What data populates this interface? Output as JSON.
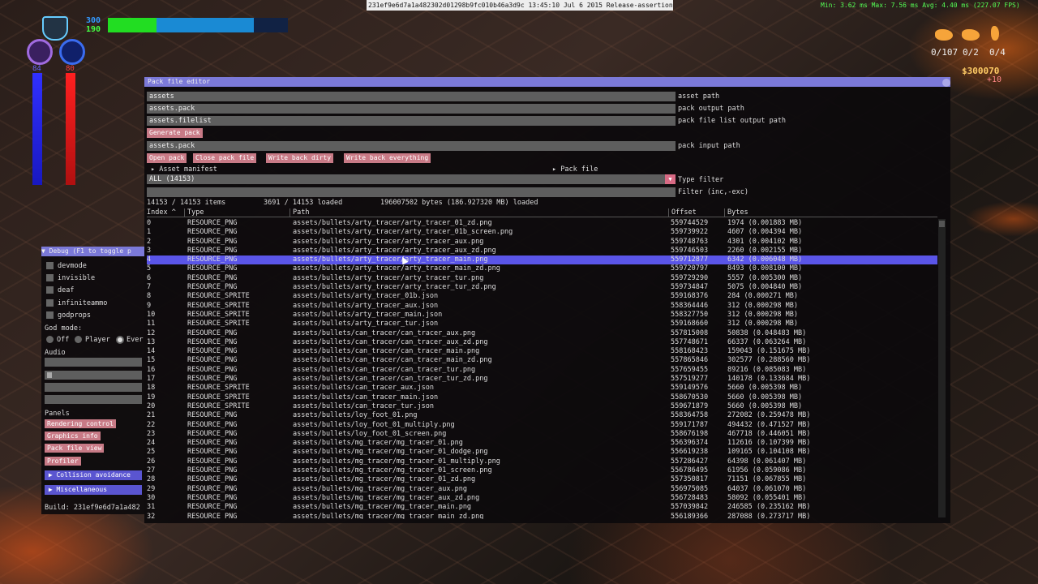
{
  "top_bar": {
    "build_string": "231ef9e6d7a1a482302d01298b9fc010b46a3d9c 13:45:10 Jul  6 2015 Release-assertions",
    "fps": "Min:  3.62 ms Max:  7.56 ms Avg:  4.40 ms (227.07 FPS)"
  },
  "hud": {
    "health_value": "300",
    "shield_value": "190",
    "left_bar_value": "84",
    "right_bar_value": "80",
    "health_fraction": 0.27,
    "shield_fraction": 0.81,
    "ammo": [
      "0/107",
      "0/2",
      "0/4"
    ],
    "money": "$300070",
    "money_delta": "+10"
  },
  "pack_editor": {
    "title": "Pack file editor",
    "fields": [
      {
        "value": "assets",
        "label": "asset path"
      },
      {
        "value": "assets.pack",
        "label": "pack output path"
      },
      {
        "value": "assets.filelist",
        "label": "pack file list output path"
      }
    ],
    "generate_button": "Generate pack",
    "input_field": {
      "value": "assets.pack",
      "label": "pack input path"
    },
    "buttons": [
      "Open pack",
      "Close pack file",
      "Write back dirty",
      "Write back everything"
    ],
    "asset_manifest": "Asset manifest",
    "pack_file": "Pack file",
    "type_filter": {
      "value": "ALL (14153)",
      "label": "Type filter"
    },
    "filter": {
      "value": "",
      "label": "Filter (inc,-exc)"
    },
    "stats": {
      "items": "14153 / 14153 items",
      "loaded": "3691 / 14153 loaded",
      "bytes": "196007502 bytes (186.927320 MB) loaded"
    },
    "columns": [
      "Index ^",
      "Type",
      "Path",
      "Offset",
      "Bytes"
    ],
    "selected_index": 4,
    "rows": [
      {
        "index": "0",
        "type": "RESOURCE_PNG",
        "path": "assets/bullets/arty_tracer/arty_tracer_01_zd.png",
        "offset": "559744529",
        "bytes": "1974 (0.001883 MB)"
      },
      {
        "index": "1",
        "type": "RESOURCE_PNG",
        "path": "assets/bullets/arty_tracer/arty_tracer_01b_screen.png",
        "offset": "559739922",
        "bytes": "4607 (0.004394 MB)"
      },
      {
        "index": "2",
        "type": "RESOURCE_PNG",
        "path": "assets/bullets/arty_tracer/arty_tracer_aux.png",
        "offset": "559748763",
        "bytes": "4301 (0.004102 MB)"
      },
      {
        "index": "3",
        "type": "RESOURCE_PNG",
        "path": "assets/bullets/arty_tracer/arty_tracer_aux_zd.png",
        "offset": "559746503",
        "bytes": "2260 (0.002155 MB)"
      },
      {
        "index": "4",
        "type": "RESOURCE_PNG",
        "path": "assets/bullets/arty_tracer/arty_tracer_main.png",
        "offset": "559712877",
        "bytes": "6342 (0.006048 MB)"
      },
      {
        "index": "5",
        "type": "RESOURCE_PNG",
        "path": "assets/bullets/arty_tracer/arty_tracer_main_zd.png",
        "offset": "559720797",
        "bytes": "8493 (0.008100 MB)"
      },
      {
        "index": "6",
        "type": "RESOURCE_PNG",
        "path": "assets/bullets/arty_tracer/arty_tracer_tur.png",
        "offset": "559729290",
        "bytes": "5557 (0.005300 MB)"
      },
      {
        "index": "7",
        "type": "RESOURCE_PNG",
        "path": "assets/bullets/arty_tracer/arty_tracer_tur_zd.png",
        "offset": "559734847",
        "bytes": "5075 (0.004840 MB)"
      },
      {
        "index": "8",
        "type": "RESOURCE_SPRITE",
        "path": "assets/bullets/arty_tracer_01b.json",
        "offset": "559168376",
        "bytes": "284 (0.000271 MB)"
      },
      {
        "index": "9",
        "type": "RESOURCE_SPRITE",
        "path": "assets/bullets/arty_tracer_aux.json",
        "offset": "558364446",
        "bytes": "312 (0.000298 MB)"
      },
      {
        "index": "10",
        "type": "RESOURCE_SPRITE",
        "path": "assets/bullets/arty_tracer_main.json",
        "offset": "558327750",
        "bytes": "312 (0.000298 MB)"
      },
      {
        "index": "11",
        "type": "RESOURCE_SPRITE",
        "path": "assets/bullets/arty_tracer_tur.json",
        "offset": "559168660",
        "bytes": "312 (0.000298 MB)"
      },
      {
        "index": "12",
        "type": "RESOURCE_PNG",
        "path": "assets/bullets/can_tracer/can_tracer_aux.png",
        "offset": "557815008",
        "bytes": "50838 (0.048483 MB)"
      },
      {
        "index": "13",
        "type": "RESOURCE_PNG",
        "path": "assets/bullets/can_tracer/can_tracer_aux_zd.png",
        "offset": "557748671",
        "bytes": "66337 (0.063264 MB)"
      },
      {
        "index": "14",
        "type": "RESOURCE_PNG",
        "path": "assets/bullets/can_tracer/can_tracer_main.png",
        "offset": "558168423",
        "bytes": "159043 (0.151675 MB)"
      },
      {
        "index": "15",
        "type": "RESOURCE_PNG",
        "path": "assets/bullets/can_tracer/can_tracer_main_zd.png",
        "offset": "557865846",
        "bytes": "302577 (0.288560 MB)"
      },
      {
        "index": "16",
        "type": "RESOURCE_PNG",
        "path": "assets/bullets/can_tracer/can_tracer_tur.png",
        "offset": "557659455",
        "bytes": "89216 (0.085083 MB)"
      },
      {
        "index": "17",
        "type": "RESOURCE_PNG",
        "path": "assets/bullets/can_tracer/can_tracer_tur_zd.png",
        "offset": "557519277",
        "bytes": "140178 (0.133684 MB)"
      },
      {
        "index": "18",
        "type": "RESOURCE_SPRITE",
        "path": "assets/bullets/can_tracer_aux.json",
        "offset": "559149576",
        "bytes": "5660 (0.005398 MB)"
      },
      {
        "index": "19",
        "type": "RESOURCE_SPRITE",
        "path": "assets/bullets/can_tracer_main.json",
        "offset": "558670530",
        "bytes": "5660 (0.005398 MB)"
      },
      {
        "index": "20",
        "type": "RESOURCE_SPRITE",
        "path": "assets/bullets/can_tracer_tur.json",
        "offset": "559671879",
        "bytes": "5660 (0.005398 MB)"
      },
      {
        "index": "21",
        "type": "RESOURCE_PNG",
        "path": "assets/bullets/loy_foot_01.png",
        "offset": "558364758",
        "bytes": "272082 (0.259478 MB)"
      },
      {
        "index": "22",
        "type": "RESOURCE_PNG",
        "path": "assets/bullets/loy_foot_01_multiply.png",
        "offset": "559171787",
        "bytes": "494432 (0.471527 MB)"
      },
      {
        "index": "23",
        "type": "RESOURCE_PNG",
        "path": "assets/bullets/loy_foot_01_screen.png",
        "offset": "558676198",
        "bytes": "467718 (0.446051 MB)"
      },
      {
        "index": "24",
        "type": "RESOURCE_PNG",
        "path": "assets/bullets/mg_tracer/mg_tracer_01.png",
        "offset": "556396374",
        "bytes": "112616 (0.107399 MB)"
      },
      {
        "index": "25",
        "type": "RESOURCE_PNG",
        "path": "assets/bullets/mg_tracer/mg_tracer_01_dodge.png",
        "offset": "556619238",
        "bytes": "109165 (0.104108 MB)"
      },
      {
        "index": "26",
        "type": "RESOURCE_PNG",
        "path": "assets/bullets/mg_tracer/mg_tracer_01_multiply.png",
        "offset": "557286427",
        "bytes": "64398 (0.061407 MB)"
      },
      {
        "index": "27",
        "type": "RESOURCE_PNG",
        "path": "assets/bullets/mg_tracer/mg_tracer_01_screen.png",
        "offset": "556786495",
        "bytes": "61956 (0.059086 MB)"
      },
      {
        "index": "28",
        "type": "RESOURCE_PNG",
        "path": "assets/bullets/mg_tracer/mg_tracer_01_zd.png",
        "offset": "557350817",
        "bytes": "71151 (0.067855 MB)"
      },
      {
        "index": "29",
        "type": "RESOURCE_PNG",
        "path": "assets/bullets/mg_tracer/mg_tracer_aux.png",
        "offset": "556975085",
        "bytes": "64037 (0.061070 MB)"
      },
      {
        "index": "30",
        "type": "RESOURCE_PNG",
        "path": "assets/bullets/mg_tracer/mg_tracer_aux_zd.png",
        "offset": "556728483",
        "bytes": "58092 (0.055401 MB)"
      },
      {
        "index": "31",
        "type": "RESOURCE_PNG",
        "path": "assets/bullets/mg_tracer/mg_tracer_main.png",
        "offset": "557039842",
        "bytes": "246585 (0.235162 MB)"
      },
      {
        "index": "32",
        "type": "RESOURCE_PNG",
        "path": "assets/bullets/mg_tracer/mg_tracer_main_zd.png",
        "offset": "556189366",
        "bytes": "287088 (0.273717 MB)"
      }
    ]
  },
  "debug": {
    "title": "Debug (F1 to toggle p",
    "checkboxes": [
      "devmode",
      "invisible",
      "deaf",
      "infiniteammo",
      "godprops"
    ],
    "god_mode_label": "God mode:",
    "god_options": [
      "Off",
      "Player",
      "Ever"
    ],
    "audio_label": "Audio",
    "panels_label": "Panels",
    "panel_buttons": [
      "Rendering control",
      "Graphics info",
      "Pack file view",
      "Profiler"
    ],
    "collapsibles": [
      "Collision avoidance",
      "Miscellaneous"
    ],
    "build": "Build: 231ef9e6d7a1a482"
  }
}
